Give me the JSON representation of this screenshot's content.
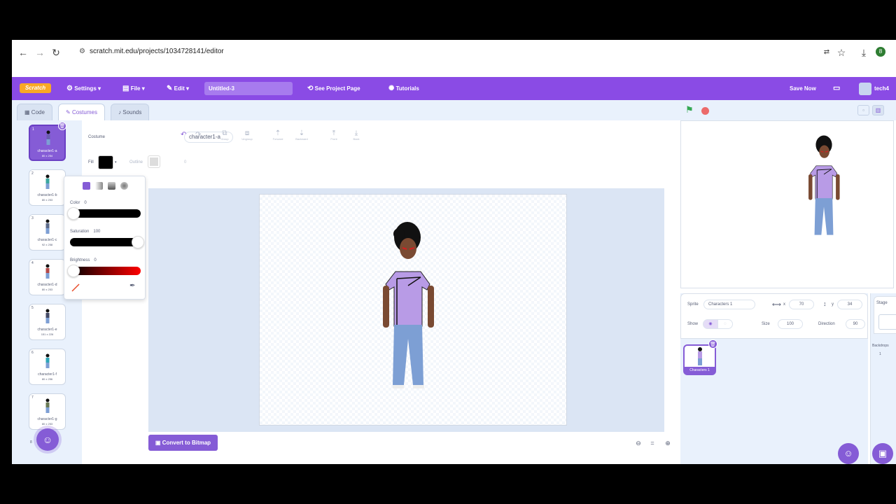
{
  "browser": {
    "url": "scratch.mit.edu/projects/1034728141/editor",
    "back": "←",
    "forward": "→",
    "reload": "↻"
  },
  "menubar": {
    "logo": "Scratch",
    "settings": "Settings",
    "file": "File",
    "edit": "Edit",
    "project_title": "Untitled-3",
    "see_project_page": "See Project Page",
    "tutorials": "Tutorials",
    "save_now": "Save Now",
    "user": "tech4"
  },
  "tabs": {
    "code": "Code",
    "costumes": "Costumes",
    "sounds": "Sounds"
  },
  "costumes": [
    {
      "num": "1",
      "name": "character1-a",
      "size": "80 x 254",
      "color": "#6b5fb0"
    },
    {
      "num": "2",
      "name": "character1-b",
      "size": "80 x 253",
      "color": "#3aa7a0"
    },
    {
      "num": "3",
      "name": "character1-c",
      "size": "92 x 258",
      "color": "#5d6b8a"
    },
    {
      "num": "4",
      "name": "character1-d",
      "size": "80 x 253",
      "color": "#b34a4a"
    },
    {
      "num": "5",
      "name": "character1-e",
      "size": "151 x 226",
      "color": "#444a66"
    },
    {
      "num": "6",
      "name": "character1-f",
      "size": "80 x 256",
      "color": "#2fa6b8"
    },
    {
      "num": "7",
      "name": "character1-g",
      "size": "80 x 253",
      "color": "#6a7a55"
    },
    {
      "num": "8",
      "name": "",
      "size": "",
      "color": "#855cd6"
    }
  ],
  "editor": {
    "costume_label": "Costume",
    "costume_name": "character1-a",
    "tools": [
      "Group",
      "Ungroup",
      "Forward",
      "Backward",
      "Front",
      "Back"
    ],
    "fill_label": "Fill",
    "outline_label": "Outline",
    "outline_value": "0",
    "convert_button": "Convert to Bitmap"
  },
  "color_picker": {
    "color_label": "Color",
    "color_value": "0",
    "saturation_label": "Saturation",
    "saturation_value": "100",
    "brightness_label": "Brightness",
    "brightness_value": "0"
  },
  "sprite_info": {
    "sprite_label": "Sprite",
    "sprite_name": "Characters 1",
    "x_label": "x",
    "x_value": "70",
    "y_label": "y",
    "y_value": "34",
    "show_label": "Show",
    "size_label": "Size",
    "size_value": "100",
    "direction_label": "Direction",
    "direction_value": "90",
    "tile_name": "Characters 1"
  },
  "stage_pane": {
    "stage_label": "Stage",
    "backdrops_label": "Backdrops",
    "backdrops_count": "1"
  },
  "colors": {
    "accent": "#855cd6",
    "menubar": "#8a4be5",
    "shirt": "#b89be6",
    "pants": "#7d9fd4"
  }
}
